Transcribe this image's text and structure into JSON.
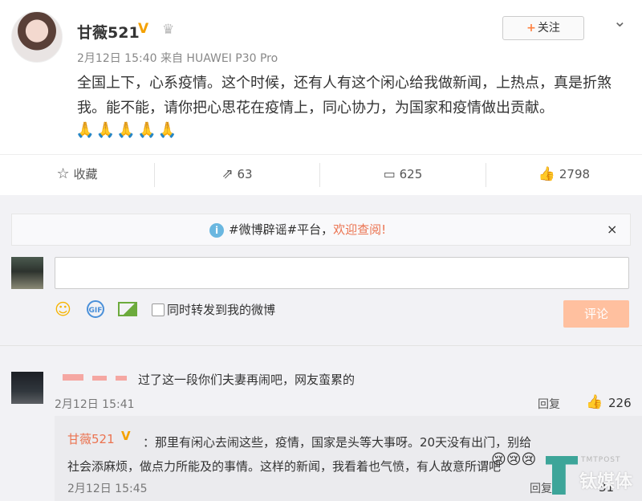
{
  "post": {
    "username": "甘薇521",
    "verified_badge": "V",
    "crown_icon": "crown-icon",
    "meta": "2月12日 15:40 来自 HUAWEI P30 Pro",
    "follow_label": "关注",
    "follow_plus": "+",
    "text": "全国上下，心系疫情。这个时候，还有人有这个闲心给我做新闻，上热点，真是折煞我。能不能，请你把心思花在疫情上，同心协力，为国家和疫情做出贡献。",
    "emojis": "🙏🙏🙏🙏🙏"
  },
  "actions": {
    "favorite": "收藏",
    "repost": "63",
    "comments": "625",
    "likes": "2798"
  },
  "notice": {
    "prefix": "#微博辟谣#平台，",
    "link": "欢迎查阅!",
    "close": "×"
  },
  "composer": {
    "repost_checkbox_label": "同时转发到我的微博",
    "submit_label": "评论",
    "gif_label": "GIF"
  },
  "comments": [
    {
      "text": "过了这一段你们夫妻再闹吧，网友蛮累的",
      "time": "2月12日 15:41",
      "reply_label": "回复",
      "likes": "226"
    }
  ],
  "reply": {
    "user": "甘薇521",
    "badge": "V",
    "text": "：那里有闲心去闹这些，疫情，国家是头等大事呀。20天没有出门，别给社会添麻烦，做点力所能及的事情。这样的新闻，我看着也气愤，有人故意所谓吧",
    "emojis": "😢😢😢",
    "time": "2月12日 15:45",
    "reply_label": "回复",
    "likes": "31"
  },
  "watermark": {
    "top_text": "TMTPOST",
    "name": "钛媒体"
  },
  "colors": {
    "accent_orange": "#eb7350",
    "verified_gold": "#f4a100",
    "submit_disabled": "#ffc09f"
  }
}
